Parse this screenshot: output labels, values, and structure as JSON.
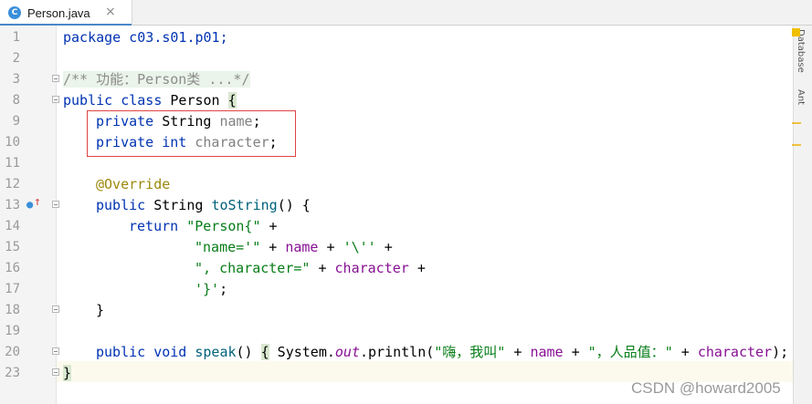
{
  "tab": {
    "icon_letter": "C",
    "filename": "Person.java",
    "close": "×"
  },
  "right_tools": [
    "Database",
    "Ant"
  ],
  "gutter": [
    "1",
    "2",
    "3",
    "8",
    "9",
    "10",
    "11",
    "12",
    "13",
    "14",
    "15",
    "16",
    "17",
    "18",
    "19",
    "20",
    "23"
  ],
  "code": {
    "l1": [
      "package c03.s01.p01;"
    ],
    "l3": [
      "/** 功能：Person类 ...*/"
    ],
    "l8": [
      "public class ",
      "Person ",
      "{"
    ],
    "l9": [
      "private ",
      "String ",
      "name",
      ";"
    ],
    "l10": [
      "private ",
      "int ",
      "character",
      ";"
    ],
    "l12": [
      "@Override"
    ],
    "l13": [
      "public ",
      "String ",
      "toString",
      "() {"
    ],
    "l14": [
      "return ",
      "\"Person{\"",
      " +"
    ],
    "l15": [
      "\"name='\"",
      " + ",
      "name",
      " + ",
      "'\\''",
      " +"
    ],
    "l16": [
      "\", character=\"",
      " + ",
      "character",
      " +"
    ],
    "l17": [
      "'}'",
      ";"
    ],
    "l18": [
      "}"
    ],
    "l20": [
      "public ",
      "void ",
      "speak",
      "() ",
      "{",
      " System.",
      "out",
      ".println(",
      "\"嗨，我叫\"",
      " + ",
      "name",
      " + ",
      "\"，人品值：\"",
      " + ",
      "character",
      ");"
    ],
    "l23": [
      "}"
    ]
  },
  "watermark": "CSDN @howard2005",
  "colors": {
    "keyword": "#0033b3",
    "string": "#067d17",
    "field": "#871094",
    "annotation": "#9e880d",
    "highlight_box": "#e04343"
  }
}
